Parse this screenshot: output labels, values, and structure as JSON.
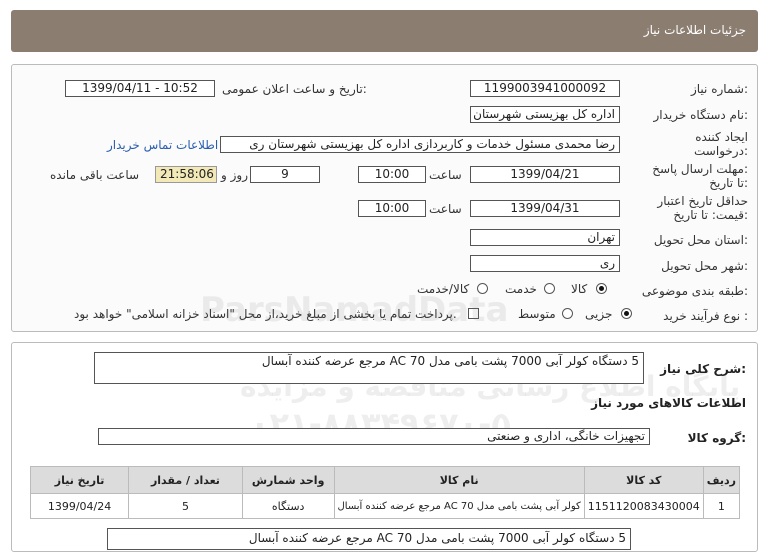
{
  "header": {
    "title": "جزئیات اطلاعات نیاز"
  },
  "form": {
    "need_number_label": "شماره نیاز:",
    "need_number": "1199003941000092",
    "announce_label": "تاریخ و ساعت اعلان عمومی:",
    "announce_value": "1399/04/11 - 10:52",
    "buyer_org_label": "نام دستگاه خریدار:",
    "buyer_org": "اداره کل بهزیستی شهرستان ری",
    "creator_label_1": "ایجاد کننده",
    "creator_label_2": "درخواست:",
    "creator": "رضا محمدی مسئول خدمات و کاربردازی اداره کل بهزیستی شهرستان ری",
    "contact_link": "اطلاعات تماس خریدار",
    "reply_label_1": "مهلت ارسال پاسخ:",
    "reply_label_2": "تا تاریخ:",
    "reply_date": "1399/04/21",
    "time_label": "ساعت",
    "reply_time": "10:00",
    "days_value": "9",
    "days_label": "روز و",
    "remaining_time": "21:58:06",
    "remaining_label": "ساعت باقی مانده",
    "validity_label_1": "حداقل تاریخ اعتبار",
    "validity_label_2": "قیمت: تا تاریخ:",
    "validity_date": "1399/04/31",
    "validity_time": "10:00",
    "province_label": "استان محل تحویل:",
    "province": "تهران",
    "city_label": "شهر محل تحویل:",
    "city": "ری",
    "category_label": "طبقه بندی موضوعی:",
    "category_options": [
      "کالا",
      "خدمت",
      "کالا/خدمت"
    ],
    "category_selected": "کالا",
    "process_label": "نوع فرآیند خرید :",
    "process_options": [
      "جزیی",
      "متوسط"
    ],
    "process_selected": "جزیی",
    "payment_note": "پرداخت تمام یا بخشی از مبلغ خرید،از محل \"اسناد خزانه اسلامی\" خواهد بود."
  },
  "details": {
    "description_label": "شرح کلی نیاز:",
    "description": "5 دستگاه کولر آبی 7000 پشت بامی مدل AC 70 مرجع عرضه کننده آبسال",
    "items_section_title": "اطلاعات کالاهای مورد نیاز",
    "group_label": "گروه کالا:",
    "group_value": "تجهیزات خانگی، اداری و صنعتی",
    "table": {
      "headers": [
        "ردیف",
        "کد کالا",
        "نام کالا",
        "واحد شمارش",
        "تعداد / مقدار",
        "تاریخ نیاز"
      ],
      "rows": [
        [
          "1",
          "1151120083430004",
          "کولر آبی پشت بامی مدل AC 70 مرجع عرضه کننده آبسال",
          "دستگاه",
          "5",
          "1399/04/24"
        ]
      ]
    },
    "bottom_description": "5 دستگاه کولر آبی 7000 پشت بامی مدل AC 70 مرجع عرضه کننده آبسال"
  },
  "watermark": {
    "line1": "ParsNamadData",
    "line2": "پایگاه اطلاع رسانی مناقصه و مزایده",
    "line3": "۰۲۱-۸۸۳۴۹۶۷۰-۵"
  }
}
